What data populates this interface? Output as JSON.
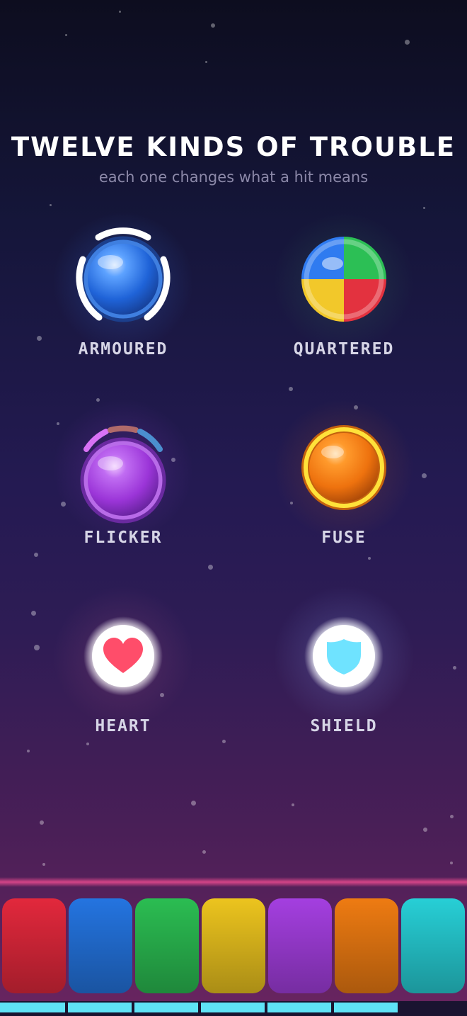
{
  "header": {
    "title": "TWELVE KINDS OF TROUBLE",
    "subtitle": "each one changes what a hit means"
  },
  "cards": [
    {
      "label": "ARMOURED",
      "icon": "armoured-orb-icon",
      "color": "#2f7bf0"
    },
    {
      "label": "QUARTERED",
      "icon": "quartered-orb-icon",
      "colors": [
        "#2f7bf0",
        "#2fc25a",
        "#f2c82a",
        "#e5323f"
      ]
    },
    {
      "label": "FLICKER",
      "icon": "flicker-orb-icon",
      "color": "#a23fe0"
    },
    {
      "label": "FUSE",
      "icon": "fuse-orb-icon",
      "color": "#f07a10"
    },
    {
      "label": "HEART",
      "icon": "heart-icon",
      "color": "#ff4d6a"
    },
    {
      "label": "SHIELD",
      "icon": "shield-icon",
      "color": "#6fe3ff"
    }
  ],
  "pads": [
    {
      "name": "red",
      "color": "#e2283c"
    },
    {
      "name": "blue",
      "color": "#2474e0"
    },
    {
      "name": "green",
      "color": "#2bbd52"
    },
    {
      "name": "yellow",
      "color": "#ecc41e"
    },
    {
      "name": "purple",
      "color": "#a43fe0"
    },
    {
      "name": "orange",
      "color": "#ee7b12"
    },
    {
      "name": "teal",
      "color": "#27cfd6"
    }
  ],
  "progress": {
    "filled_segments": 6,
    "total_segments": 7,
    "color": "#5ee3f6"
  }
}
